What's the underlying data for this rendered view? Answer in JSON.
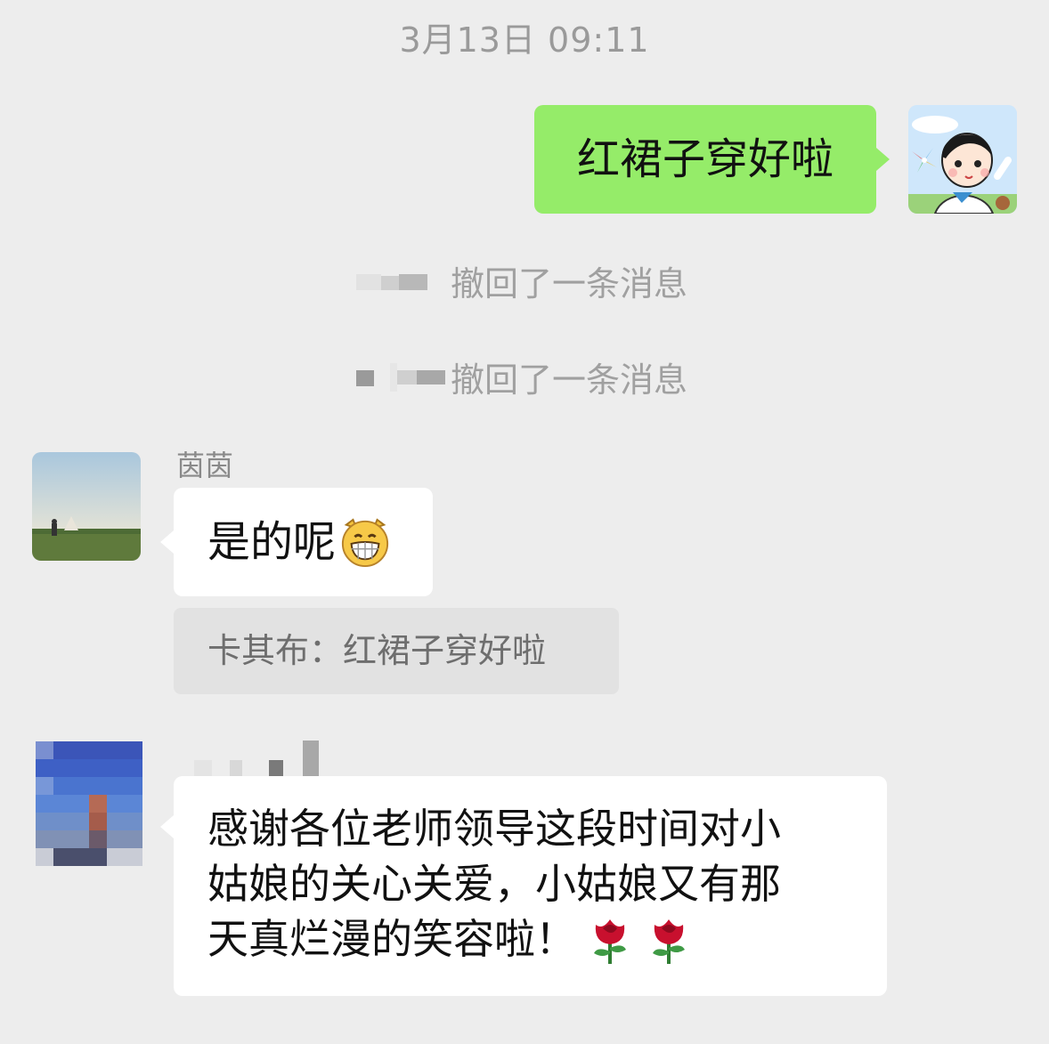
{
  "timestamp": "3月13日 09:11",
  "outgoing": {
    "text": "红裙子穿好啦"
  },
  "recalls": [
    {
      "text": "撤回了一条消息"
    },
    {
      "text": "撤回了一条消息"
    }
  ],
  "incoming1": {
    "sender": "茵茵",
    "text": "是的呢"
  },
  "quote": {
    "text": "卡其布：红裙子穿好啦"
  },
  "incoming2": {
    "line1": "感谢各位老师领导这段时间对小",
    "line2": "姑娘的关心关爱，小姑娘又有那",
    "line3": "天真烂漫的笑容啦！"
  },
  "colors": {
    "background": "#ededed",
    "outgoing_bubble": "#95ec69",
    "incoming_bubble": "#ffffff"
  }
}
